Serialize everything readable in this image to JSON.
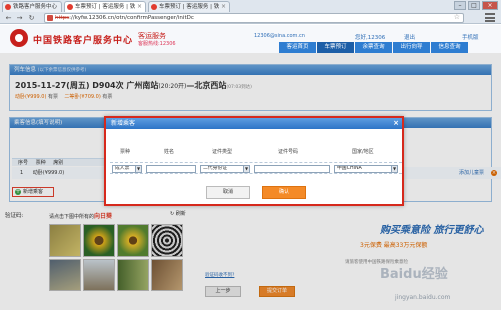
{
  "browser": {
    "tabs": [
      {
        "label": "铁路客户服务中心",
        "active": false
      },
      {
        "label": "车票预订 | 客运服务 | 铁",
        "active": true
      },
      {
        "label": "车票预订 | 客运服务 | 铁",
        "active": false
      }
    ],
    "url_scheme": "https",
    "url_rest": "://kyfw.12306.cn/otn/confirmPassenger/initDc"
  },
  "header": {
    "title": "中国铁路客户服务中心",
    "subtitle": "客运服务",
    "phone": "客服热线:12306",
    "email": "12306@sina.com.cn",
    "user": "您好,12306",
    "nav_links": [
      "退出",
      "手机版"
    ],
    "tabs": [
      "客运首页",
      "车票预订",
      "余票查询",
      "出行向导",
      "信息查询"
    ],
    "active_tab": 1
  },
  "trip": {
    "heading": "列车信息",
    "heading_note": "(以下余票信息仅供参考)",
    "date": "2015-11-27(周五)",
    "train": "D904次",
    "from": "广州南站",
    "time": "(20:20开)",
    "to": "北京西站",
    "note": "(07:03到达)",
    "prices": [
      "动卧(¥999.0)",
      "有票",
      "二等卧(¥709.0)",
      "有票"
    ]
  },
  "passengers": {
    "heading": "乘客信息(填写说明)",
    "table_cols": [
      "序号",
      "票种",
      "席别"
    ],
    "row": [
      "1",
      "动卧(¥999.0)"
    ],
    "add_label": "新增乘客",
    "add_child": "添加儿童票"
  },
  "captcha": {
    "label": "验证码:",
    "prompt_pre": "请点击下图中所有的",
    "keyword": "向日葵",
    "refresh": "刷新",
    "sms": "验证码收不到?"
  },
  "promo": {
    "title": "购买乘意险 旅行更舒心",
    "sub": "3元保费 最高33万元保额",
    "note": "请旅客使用中国铁路保险乘意险",
    "watermark": "Baidu经验",
    "watermark2": "jingyan.baidu.com"
  },
  "actions": {
    "prev": "上一步",
    "submit": "提交订单"
  },
  "modal": {
    "title": "新增乘客",
    "columns": [
      "票种",
      "姓名",
      "证件类型",
      "证件号码",
      "国家/地区"
    ],
    "ticket_type": "成人票",
    "id_type": "二代身份证",
    "country": "中国CHINA",
    "cancel": "取消",
    "ok": "确认"
  },
  "colors": {
    "accent": "#2e7dd1",
    "highlight": "#d6291c",
    "button": "#f48a27"
  }
}
